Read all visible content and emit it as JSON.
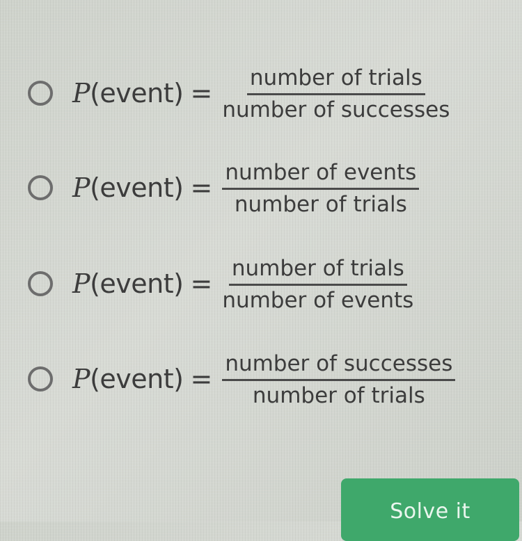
{
  "question": {
    "lhs_prefix": "P",
    "lhs_suffix": "(event)",
    "equals": "=",
    "options": [
      {
        "numerator": "number of trials",
        "denominator": "number of successes"
      },
      {
        "numerator": "number of events",
        "denominator": "number of trials"
      },
      {
        "numerator": "number of trials",
        "denominator": "number of events"
      },
      {
        "numerator": "number of successes",
        "denominator": "number of trials"
      }
    ]
  },
  "actions": {
    "solve_label": "Solve it"
  },
  "colors": {
    "background": "#d2d5cf",
    "text": "#3c3c3c",
    "button": "#3fa86b",
    "button_text": "#eaf6ee"
  }
}
